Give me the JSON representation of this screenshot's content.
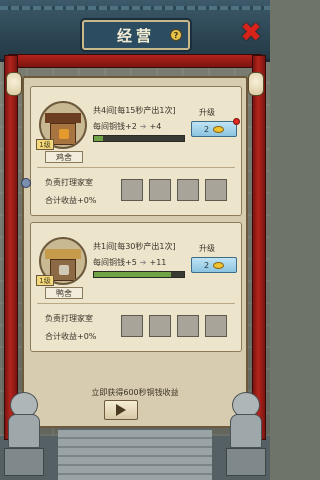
{
  "header": {
    "title": "经营",
    "help_icon": "question-icon",
    "close_icon": "close-icon",
    "close_glyph": "✖",
    "help_glyph": "?"
  },
  "buildings": [
    {
      "name": "鸡舍",
      "level": "1级",
      "line1": "共4间[每15秒产出1次]",
      "coin_label": "每间铜钱+2",
      "arrow": "➔",
      "coin_next": "+4",
      "progress": 0.1,
      "upgrade_label": "升级",
      "upgrade_cost": "2",
      "staff_label": "负责打理家室",
      "total_label": "合计收益+0%"
    },
    {
      "name": "鸭舍",
      "level": "1级",
      "line1": "共1间[每30秒产出1次]",
      "coin_label": "每间铜钱+5",
      "arrow": "➔",
      "coin_next": "+11",
      "progress": 0.85,
      "upgrade_label": "升级",
      "upgrade_cost": "2",
      "staff_label": "负责打理家室",
      "total_label": "合计收益+0%"
    }
  ],
  "footer": {
    "instant_text": "立即获得600秒铜钱收益",
    "play_icon": "play-icon"
  },
  "colors": {
    "progress_fill": "#6fa346",
    "accent_red": "#d8231b",
    "plaque": "#2c4c61"
  }
}
